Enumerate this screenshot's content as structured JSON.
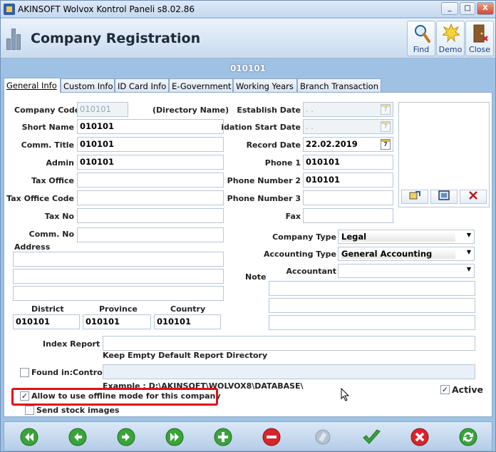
{
  "window": {
    "title": "AKINSOFT Wolvox Kontrol Paneli s8.02.86",
    "minimize": "_",
    "maximize": "□",
    "close": "X"
  },
  "header": {
    "title": "Company Registration",
    "buttons": [
      {
        "label": "Find",
        "icon": "magnifier-icon"
      },
      {
        "label": "Demo",
        "icon": "starburst-icon"
      },
      {
        "label": "Close",
        "icon": "door-exit-icon"
      }
    ]
  },
  "company_code_banner": "010101",
  "tabs": [
    {
      "label": "General Info",
      "active": true
    },
    {
      "label": "Custom Info",
      "active": false
    },
    {
      "label": "ID Card Info",
      "active": false
    },
    {
      "label": "E-Government",
      "active": false
    },
    {
      "label": "Working Years",
      "active": false
    },
    {
      "label": "Branch Transaction",
      "active": false
    }
  ],
  "form": {
    "company_code": {
      "label": "Company Code",
      "value": "010101"
    },
    "directory_name_label": "(Directory Name)",
    "short_name": {
      "label": "Short Name",
      "value": "010101"
    },
    "comm_title": {
      "label": "Comm. Title",
      "value": "010101"
    },
    "admin": {
      "label": "Admin",
      "value": "010101"
    },
    "tax_office": {
      "label": "Tax Office",
      "value": ""
    },
    "tax_office_code": {
      "label": "Tax Office Code",
      "value": ""
    },
    "tax_no": {
      "label": "Tax No",
      "value": ""
    },
    "comm_no": {
      "label": "Comm. No",
      "value": ""
    },
    "address_label": "Address",
    "district": {
      "label": "District",
      "value": "010101"
    },
    "province": {
      "label": "Province",
      "value": "010101"
    },
    "country": {
      "label": "Country",
      "value": "010101"
    },
    "establish_date": {
      "label": "Establish Date",
      "value": ". ."
    },
    "liquidation_start_date": {
      "label": "idation Start Date",
      "value": ". ."
    },
    "record_date": {
      "label": "Record Date",
      "value": "22.02.2019"
    },
    "date_icon_text": "7",
    "phone1": {
      "label": "Phone 1",
      "value": "010101"
    },
    "phone2": {
      "label": "Phone Number 2",
      "value": "010101"
    },
    "phone3": {
      "label": "Phone Number 3",
      "value": ""
    },
    "fax": {
      "label": "Fax",
      "value": ""
    },
    "company_type": {
      "label": "Company Type",
      "value": "Legal"
    },
    "accounting_type": {
      "label": "Accounting Type",
      "value": "General Accounting"
    },
    "accountant": {
      "label": "Accountant",
      "value": ""
    },
    "note_label": "Note",
    "index_report": {
      "label": "Index Report",
      "value": ""
    },
    "index_report_hint": "Keep Empty Default Report Directory",
    "found_in": {
      "label": "Found in:Control P",
      "checked": false
    },
    "example_text": "Example : D:\\AKINSOFT\\WOLVOX8\\DATABASE\\",
    "offline_mode": {
      "label": "Allow to use offline mode for this company",
      "checked": true
    },
    "send_stock_images": {
      "label": "Send stock images",
      "checked": false
    },
    "active": {
      "label": "Active",
      "checked": true
    }
  },
  "image_buttons": [
    "load-image-icon",
    "view-image-icon",
    "delete-image-icon"
  ],
  "nav_buttons": [
    {
      "name": "first-record",
      "color": "#3aa33a"
    },
    {
      "name": "previous-record",
      "color": "#3aa33a"
    },
    {
      "name": "next-record",
      "color": "#3aa33a"
    },
    {
      "name": "last-record",
      "color": "#3aa33a"
    },
    {
      "name": "add-record",
      "color": "#3aa33a"
    },
    {
      "name": "delete-record",
      "color": "#d8242a"
    },
    {
      "name": "edit-record",
      "color": "#9aa8b8"
    },
    {
      "name": "save-record",
      "color": "#3aa33a"
    },
    {
      "name": "cancel-record",
      "color": "#d8242a"
    },
    {
      "name": "refresh-record",
      "color": "#3aa33a"
    }
  ]
}
